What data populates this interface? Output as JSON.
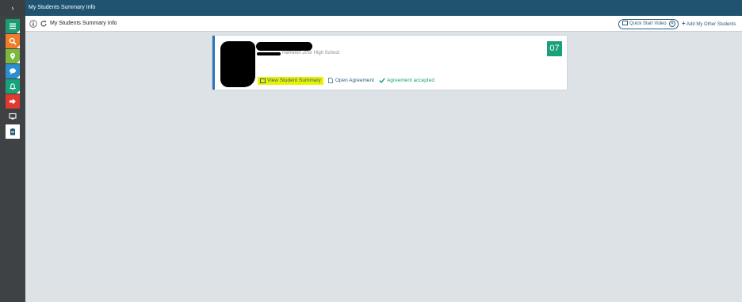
{
  "topbar": {
    "expand_glyph": "›",
    "title": "My Students Summary Info"
  },
  "sidebar": {
    "items": [
      {
        "icon": "menu-icon",
        "color": "#1a9b72"
      },
      {
        "icon": "search-icon",
        "color": "#f17c2b"
      },
      {
        "icon": "map-pin-icon",
        "color": "#7ab83e"
      },
      {
        "icon": "chat-icon",
        "color": "#2c8fcf"
      },
      {
        "icon": "bell-icon",
        "color": "#19a17a"
      },
      {
        "icon": "sign-out-icon",
        "color": "#e03a2e"
      },
      {
        "icon": "monitor-icon",
        "color": "#3f4244"
      },
      {
        "icon": "clipboard-icon",
        "color": "#ffffff"
      }
    ]
  },
  "toolbar": {
    "breadcrumb": "My Students Summary Info",
    "quick_start_video": "Quick Start Video",
    "add_other": "Add My Other Students"
  },
  "student_card": {
    "school": "Hamilton Jr/Sr High School",
    "grade": "07",
    "view_summary": "View Student Summary",
    "open_agreement": "Open Agreement",
    "agreement_status": "Agreement accepted"
  },
  "colors": {
    "topbar": "#20536f",
    "accent": "#2b5f7f",
    "grade_badge": "#1aa07a",
    "highlight": "#e9f300"
  }
}
